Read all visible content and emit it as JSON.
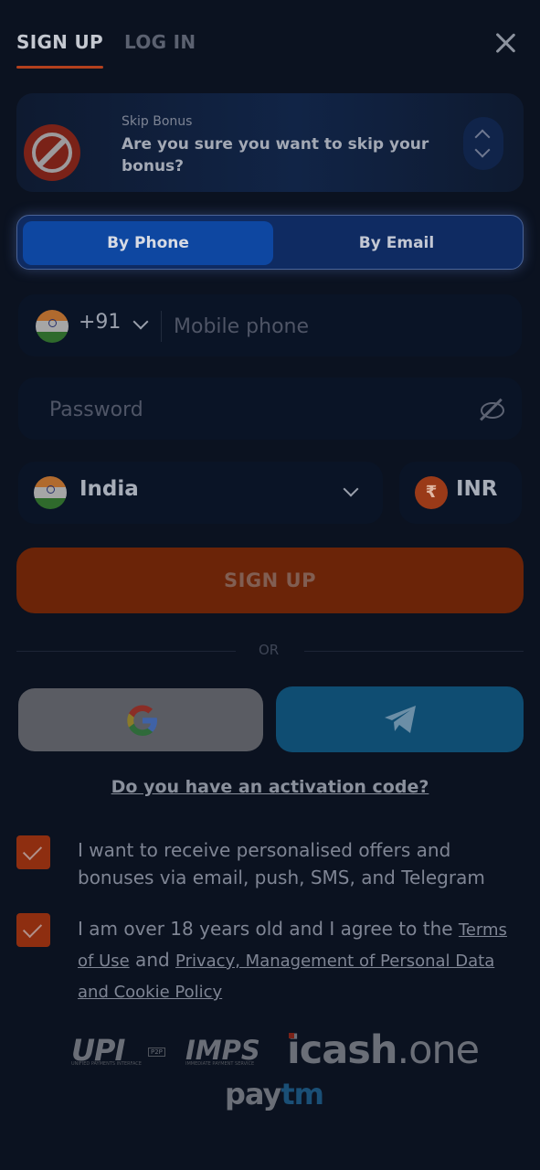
{
  "tabs": {
    "signup": "SIGN UP",
    "login": "LOG IN"
  },
  "bonus": {
    "title": "Skip Bonus",
    "question": "Are you sure you want to skip your bonus?"
  },
  "method": {
    "phone": "By Phone",
    "email": "By Email",
    "selected": "By Phone"
  },
  "phone": {
    "dial_code": "+91",
    "placeholder": "Mobile phone",
    "value": ""
  },
  "password": {
    "placeholder": "Password",
    "value": ""
  },
  "country": {
    "name": "India"
  },
  "currency": {
    "symbol": "₹",
    "code": "INR"
  },
  "signup_button": "SIGN UP",
  "divider": "OR",
  "social": {
    "google_icon": "google-icon",
    "telegram_icon": "telegram-icon"
  },
  "activation_link": "Do you have an activation code?",
  "consent": {
    "offers": {
      "text": "I want to receive personalised offers and bonuses via email, push, SMS, and Telegram",
      "checked": true
    },
    "age": {
      "prefix": "I am over 18 years old and I agree to the ",
      "terms": "Terms of Use",
      "and": " and ",
      "privacy": "Privacy, Management of Personal Data and Cookie Policy",
      "checked": true
    }
  },
  "payments": {
    "upi": "UPI",
    "upi_sub": "UNIFIED PAYMENTS INTERFACE",
    "upi_badge": "P2P",
    "imps": "IMPS",
    "imps_sub": "IMMEDIATE PAYMENT SERVICE",
    "icash_main": "icash",
    "icash_suffix": ".one",
    "paytm_pay": "pay",
    "paytm_tm": "tm"
  },
  "colors": {
    "background": "#0b1220",
    "accent": "#b3401d",
    "primary_blue": "#0e47a1",
    "telegram": "#0f4d72"
  }
}
